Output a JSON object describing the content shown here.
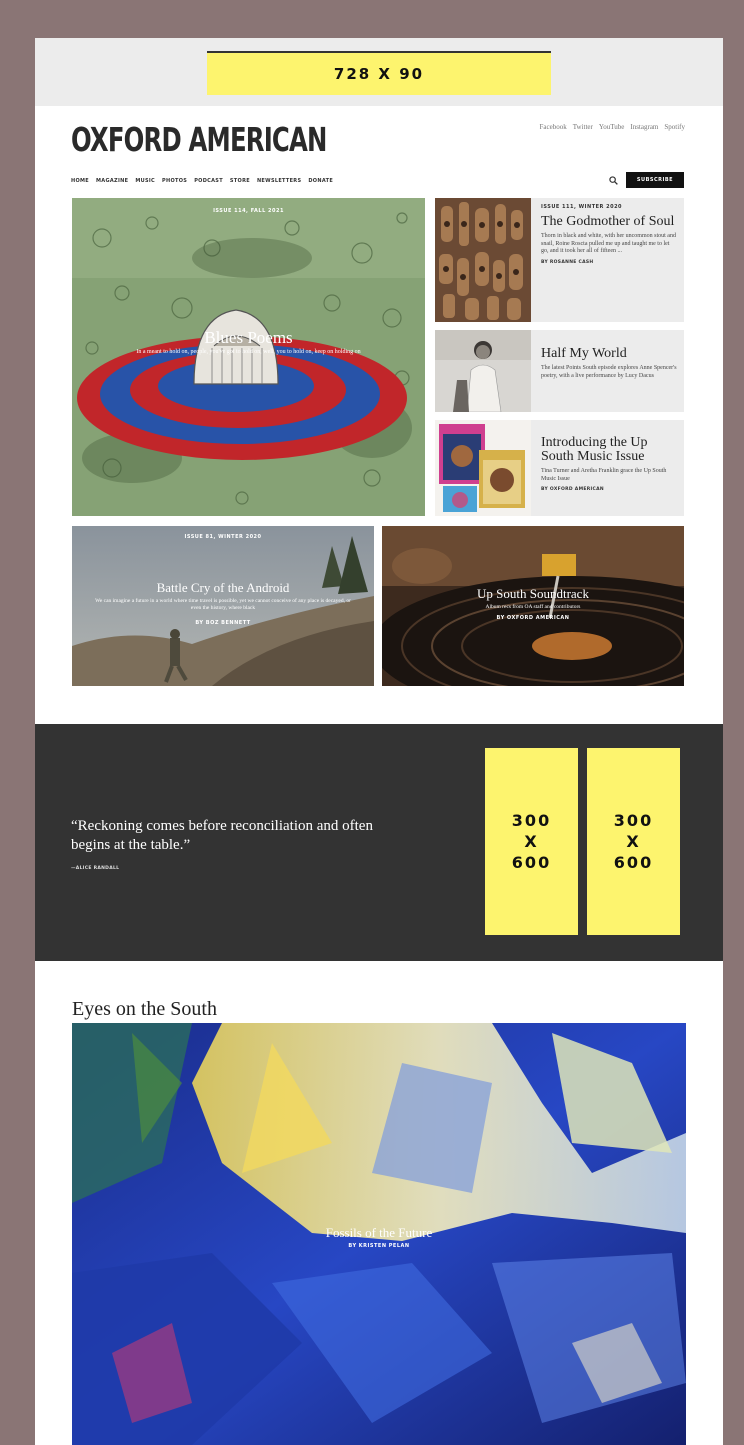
{
  "ad_banner": {
    "label": "728 X 90"
  },
  "site": {
    "logo": "OXFORD AMERICAN"
  },
  "social": [
    "Facebook",
    "Twitter",
    "YouTube",
    "Instagram",
    "Spotify"
  ],
  "nav": [
    "HOME",
    "MAGAZINE",
    "MUSIC",
    "PHOTOS",
    "PODCAST",
    "STORE",
    "NEWSLETTERS",
    "DONATE"
  ],
  "header": {
    "search_icon": "search-icon",
    "subscribe_label": "SUBSCRIBE"
  },
  "hero": {
    "kicker": "ISSUE 114, FALL 2021",
    "title": "Blues Poems",
    "dek": "In a meant to hold on, people, you've got to hold on, well, you to hold on, keep on holding on"
  },
  "side_cards": [
    {
      "kicker": "ISSUE 111, WINTER 2020",
      "title": "The Godmother of Soul",
      "desc": "Thorn in black and white, with her uncommon stout and snail, Roine Roscta pulled me up and taught me to let go, and it took her all of fifteen ...",
      "byline": "BY ROSANNE CASH"
    },
    {
      "title": "Half My World",
      "desc": "The latest Points South episode explores Anne Spencer's poetry, with a live performance by Lucy Dacus"
    },
    {
      "title": "Introducing the Up South Music Issue",
      "desc": "Tina Turner and Aretha Franklin grace the Up South Music Issue",
      "byline": "BY OXFORD AMERICAN"
    }
  ],
  "wide_cards": [
    {
      "kicker": "ISSUE 81, WINTER 2020",
      "title": "Battle Cry of the Android",
      "dek": "We can imagine a future in a world where time travel is possible, yet we cannot conceive of any place is decayed, or even the history, where black",
      "byline": "BY BOZ BENNETT"
    },
    {
      "title": "Up South Soundtrack",
      "dek": "Album recs from OA staff and contributors",
      "byline": "BY OXFORD AMERICAN"
    }
  ],
  "quote": {
    "text": "“Reckoning comes before reconciliation and often begins at the table.”",
    "byline": "—ALICE RANDALL"
  },
  "side_ads": [
    {
      "line1": "300",
      "line2": "X",
      "line3": "600"
    },
    {
      "line1": "300",
      "line2": "X",
      "line3": "600"
    }
  ],
  "eyes": {
    "heading": "Eyes on the South"
  },
  "feature": {
    "title": "Fossils of the Future",
    "byline": "BY KRISTEN PELAN"
  }
}
